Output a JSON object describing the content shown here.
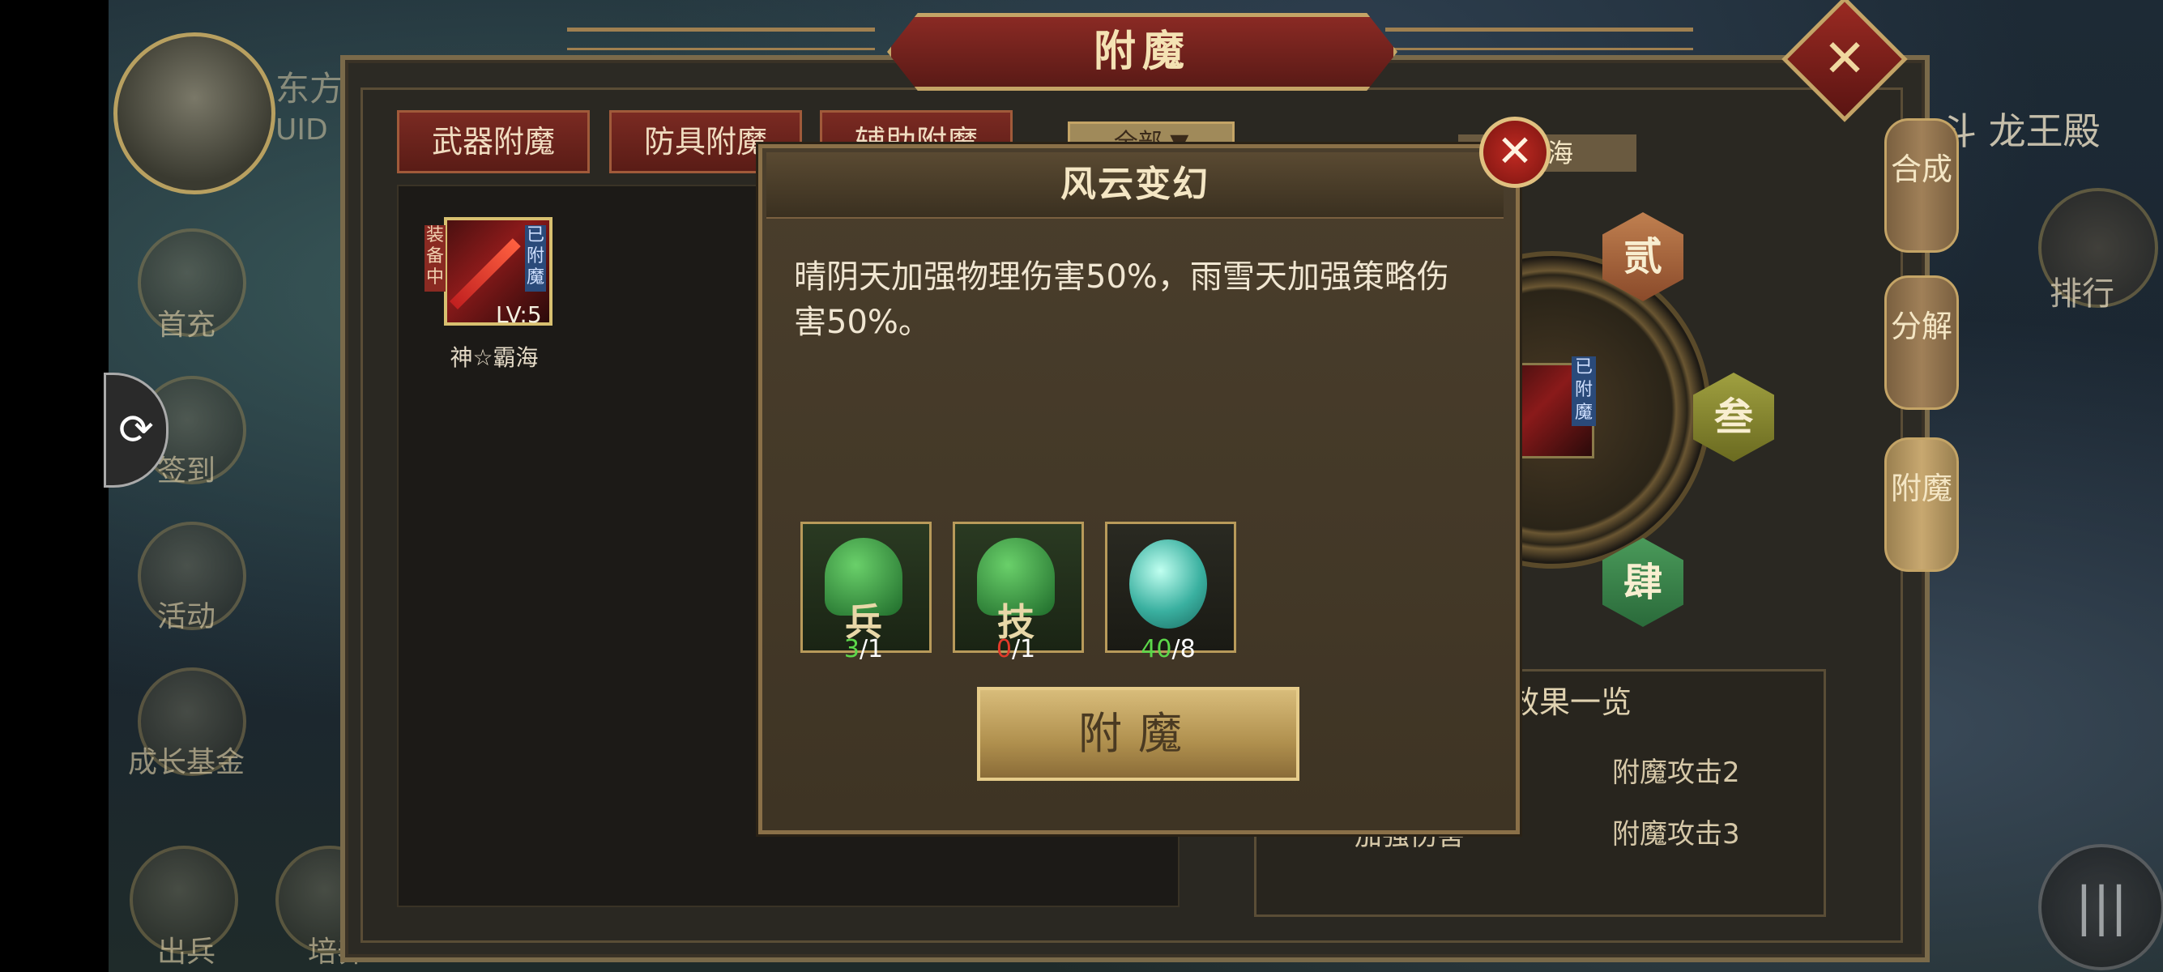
{
  "header": {
    "title": "附魔"
  },
  "player": {
    "name": "东方",
    "uid_label": "UID"
  },
  "side_menu": [
    {
      "label": "首充"
    },
    {
      "label": "签到"
    },
    {
      "label": "活动"
    },
    {
      "label": "成长基金"
    },
    {
      "label": "出兵"
    },
    {
      "label": "培养"
    }
  ],
  "tabs": [
    {
      "label": "武器附魔"
    },
    {
      "label": "防具附魔"
    },
    {
      "label": "辅助附魔"
    }
  ],
  "filter": {
    "label": "全部"
  },
  "item": {
    "tag_left": "装备中",
    "tag_right": "已附魔",
    "level": "LV:5",
    "name": "神☆霸海"
  },
  "equip": {
    "name": "霸海",
    "slot_tag": "已附魔"
  },
  "slots": {
    "two": "贰",
    "three": "叁",
    "four": "肆"
  },
  "effects": {
    "title": "效果一览",
    "rows": [
      {
        "left": "",
        "right": "附魔攻击2"
      },
      {
        "left": "加强伤害",
        "right": "附魔攻击3"
      }
    ]
  },
  "right_tabs": [
    {
      "label": "合成"
    },
    {
      "label": "分解"
    },
    {
      "label": "附魔"
    }
  ],
  "top_right": {
    "text": "斗 龙王殿"
  },
  "rank": {
    "label": "排行"
  },
  "modal": {
    "title": "风云变幻",
    "description": "晴阴天加强物理伤害50%，雨雪天加强策略伤害50%。",
    "materials": [
      {
        "glyph": "兵",
        "have": "3",
        "need": "/1",
        "have_color": "#5cd84a"
      },
      {
        "glyph": "技",
        "have": "0",
        "need": "/1",
        "have_color": "#e23a2a"
      },
      {
        "glyph": "",
        "have": "40",
        "need": "/8",
        "have_color": "#5cd84a"
      }
    ],
    "enchant_button": "附魔"
  }
}
